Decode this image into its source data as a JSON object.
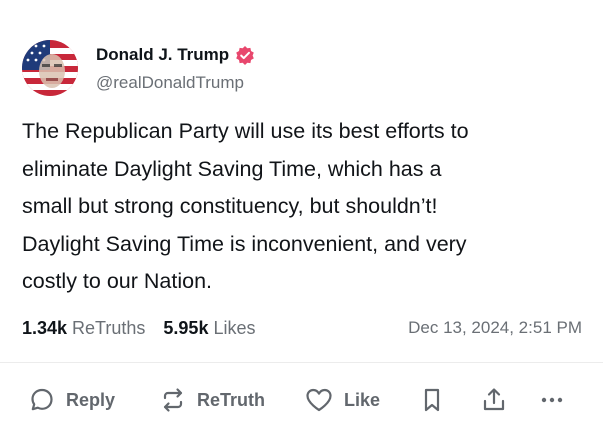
{
  "author": {
    "display_name": "Donald J. Trump",
    "handle": "@realDonaldTrump",
    "verified": true,
    "verified_color": "#e8476d"
  },
  "post": {
    "text": "The Republican Party will use its best efforts to\neliminate Daylight Saving Time, which has a\nsmall but strong constituency, but shouldn’t!\nDaylight Saving Time is inconvenient, and very\ncostly to our Nation."
  },
  "stats": {
    "retruths_count": "1.34k",
    "retruths_label": "ReTruths",
    "likes_count": "5.95k",
    "likes_label": "Likes",
    "timestamp": "Dec 13, 2024, 2:51 PM"
  },
  "actions": {
    "reply_label": "Reply",
    "retruth_label": "ReTruth",
    "like_label": "Like"
  },
  "icons": {
    "reply": "speech-bubble-icon",
    "retruth": "retruth-arrows-icon",
    "like": "heart-icon",
    "bookmark": "bookmark-icon",
    "share": "share-upload-icon",
    "more": "more-dots-icon",
    "verified": "verified-badge-icon"
  }
}
